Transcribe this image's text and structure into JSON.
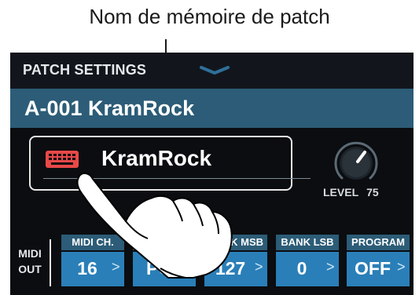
{
  "annotation": {
    "label": "Nom de mémoire de patch"
  },
  "header": {
    "title": "PATCH SETTINGS",
    "collapse_icon": "chevron-down-icon"
  },
  "patch": {
    "full_name": "A-001 KramRock",
    "name": "KramRock",
    "type_icon": "keyboard-icon"
  },
  "level": {
    "label": "LEVEL",
    "value": "75"
  },
  "midi_out": {
    "label_line1": "MIDI",
    "label_line2": "OUT",
    "cells": [
      {
        "label": "MIDI CH.",
        "value": "16"
      },
      {
        "label": "PC",
        "value": "PC"
      },
      {
        "label": "BANK MSB",
        "value": "127"
      },
      {
        "label": "BANK LSB",
        "value": "0"
      },
      {
        "label": "PROGRAM",
        "value": "OFF"
      }
    ]
  },
  "colors": {
    "accent": "#2c5c77",
    "cell": "#2a7fb8",
    "icon": "#e84848",
    "background": "#0b0d10"
  }
}
